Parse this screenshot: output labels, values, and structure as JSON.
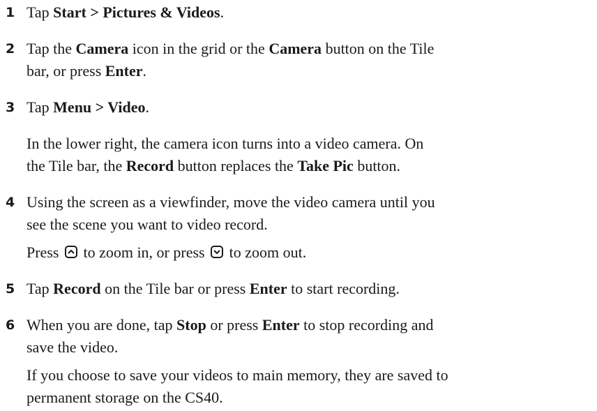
{
  "steps": [
    {
      "number": "1",
      "lines": [
        [
          "Tap ",
          "Start > Pictures & Videos",
          "."
        ]
      ]
    },
    {
      "number": "2",
      "lines": [
        [
          "Tap the ",
          "Camera",
          " icon in the grid or the ",
          "Camera",
          " button on the Tile"
        ],
        [
          "bar, or press ",
          "Enter",
          "."
        ]
      ]
    },
    {
      "number": "3",
      "lines": [
        [
          "Tap ",
          "Menu > Video",
          "."
        ]
      ]
    },
    {
      "number": "4",
      "lines": [
        [
          "Using the screen as a viewfinder, move the video camera until you"
        ],
        [
          "see the scene you want to video record."
        ]
      ]
    },
    {
      "number": "5",
      "lines": [
        [
          "Tap ",
          "Record",
          " on the Tile bar or press ",
          "Enter",
          " to start recording."
        ]
      ]
    },
    {
      "number": "6",
      "lines": [
        [
          "When you are done, tap ",
          "Stop",
          " or press ",
          "Enter",
          " to stop recording and"
        ],
        [
          "save the video."
        ]
      ]
    }
  ],
  "notes": {
    "after_step3": [
      [
        "In the lower right, the camera icon turns into a video camera. On"
      ],
      [
        "the Tile bar, the ",
        "Record",
        " button replaces the ",
        "Take Pic",
        " button."
      ]
    ],
    "after_step4": {
      "press_1": "Press ",
      "zoom_in_icon": "up-arrow-key",
      "mid": " to zoom in, or press ",
      "zoom_out_icon": "down-arrow-key",
      "end": " to zoom out."
    },
    "after_step6": [
      [
        "If you choose to save your videos to main memory, they are saved to"
      ],
      [
        "permanent storage on the CS40."
      ]
    ]
  }
}
